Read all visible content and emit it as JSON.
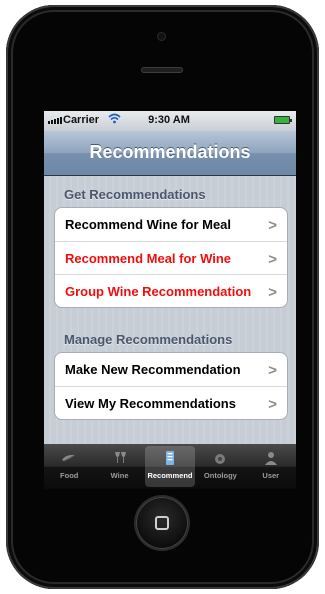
{
  "status_bar": {
    "carrier": "Carrier",
    "time": "9:30 AM"
  },
  "nav": {
    "title": "Recommendations"
  },
  "sections": [
    {
      "header": "Get Recommendations",
      "items": [
        {
          "label": "Recommend Wine for Meal",
          "color": "#000000"
        },
        {
          "label": "Recommend Meal for Wine",
          "color": "#f20d0d"
        },
        {
          "label": "Group Wine Recommendation",
          "color": "#f20d0d"
        }
      ]
    },
    {
      "header": "Manage Recommendations",
      "items": [
        {
          "label": "Make New Recommendation",
          "color": "#000000"
        },
        {
          "label": "View My Recommendations",
          "color": "#000000"
        }
      ]
    }
  ],
  "tabs": [
    {
      "label": "Food",
      "icon": "food-icon",
      "active": false
    },
    {
      "label": "Wine",
      "icon": "wine-glass-icon",
      "active": false
    },
    {
      "label": "Recommend",
      "icon": "recommend-icon",
      "active": true
    },
    {
      "label": "Ontology",
      "icon": "ontology-icon",
      "active": false
    },
    {
      "label": "User",
      "icon": "user-icon",
      "active": false
    }
  ],
  "chevron": ">"
}
